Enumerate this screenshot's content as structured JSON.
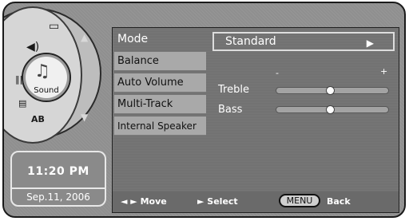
{
  "dial": {
    "sound_label": "Sound",
    "items": [
      {
        "icon": "picture-icon",
        "glyph": "▭"
      },
      {
        "icon": "speaker-icon",
        "glyph": "🔈"
      },
      {
        "icon": "equalizer-icon",
        "glyph": "⫼"
      },
      {
        "icon": "caption-icon",
        "glyph": "▤"
      },
      {
        "icon": "ab-icon",
        "glyph": "AB"
      }
    ]
  },
  "clock": {
    "time": "11:20 PM",
    "date": "Sep.11, 2006"
  },
  "menu": {
    "items": [
      "Mode",
      "Balance",
      "Auto Volume",
      "Multi-Track",
      "Internal Speaker"
    ]
  },
  "mode_value": "Standard",
  "scale": {
    "minus": "-",
    "plus": "+"
  },
  "sliders": [
    {
      "label": "Treble",
      "level": 0.48
    },
    {
      "label": "Bass",
      "level": 0.48
    }
  ],
  "footer": {
    "move": "◄ ► Move",
    "select": "► Select",
    "menu_key": "MENU",
    "back": "Back"
  }
}
